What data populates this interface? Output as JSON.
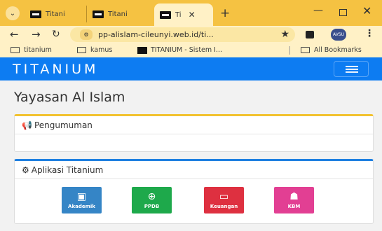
{
  "browser": {
    "tabs": [
      {
        "label": "Titani",
        "active": false
      },
      {
        "label": "Titani",
        "active": false
      },
      {
        "label": "Ti",
        "active": true
      }
    ],
    "url": "pp-alislam-cileunyi.web.id/ti...",
    "bookmarks": [
      "titanium",
      "kamus",
      "TITANIUM - Sistem I..."
    ],
    "all_bookmarks_label": "All Bookmarks",
    "avatar_text": "AVSU"
  },
  "header": {
    "brand": "TITANIUM"
  },
  "page": {
    "title": "Yayasan Al Islam"
  },
  "panels": {
    "announcements": {
      "title": "Pengumuman"
    },
    "apps": {
      "title": "Aplikasi Titanium",
      "items": [
        {
          "label": "Akademik",
          "icon": "chalkboard-teacher-icon",
          "color": "#3585c6"
        },
        {
          "label": "PPDB",
          "icon": "globe-icon",
          "color": "#1ea94b"
        },
        {
          "label": "Keuangan",
          "icon": "money-bill-icon",
          "color": "#de3040"
        },
        {
          "label": "KBM",
          "icon": "book-reader-icon",
          "color": "#e23f93"
        }
      ]
    }
  },
  "colors": {
    "browser_frame": "#f5c242",
    "header": "#0d7cf2",
    "announcement_accent": "#f2c230",
    "apps_accent": "#1f7fe0"
  }
}
